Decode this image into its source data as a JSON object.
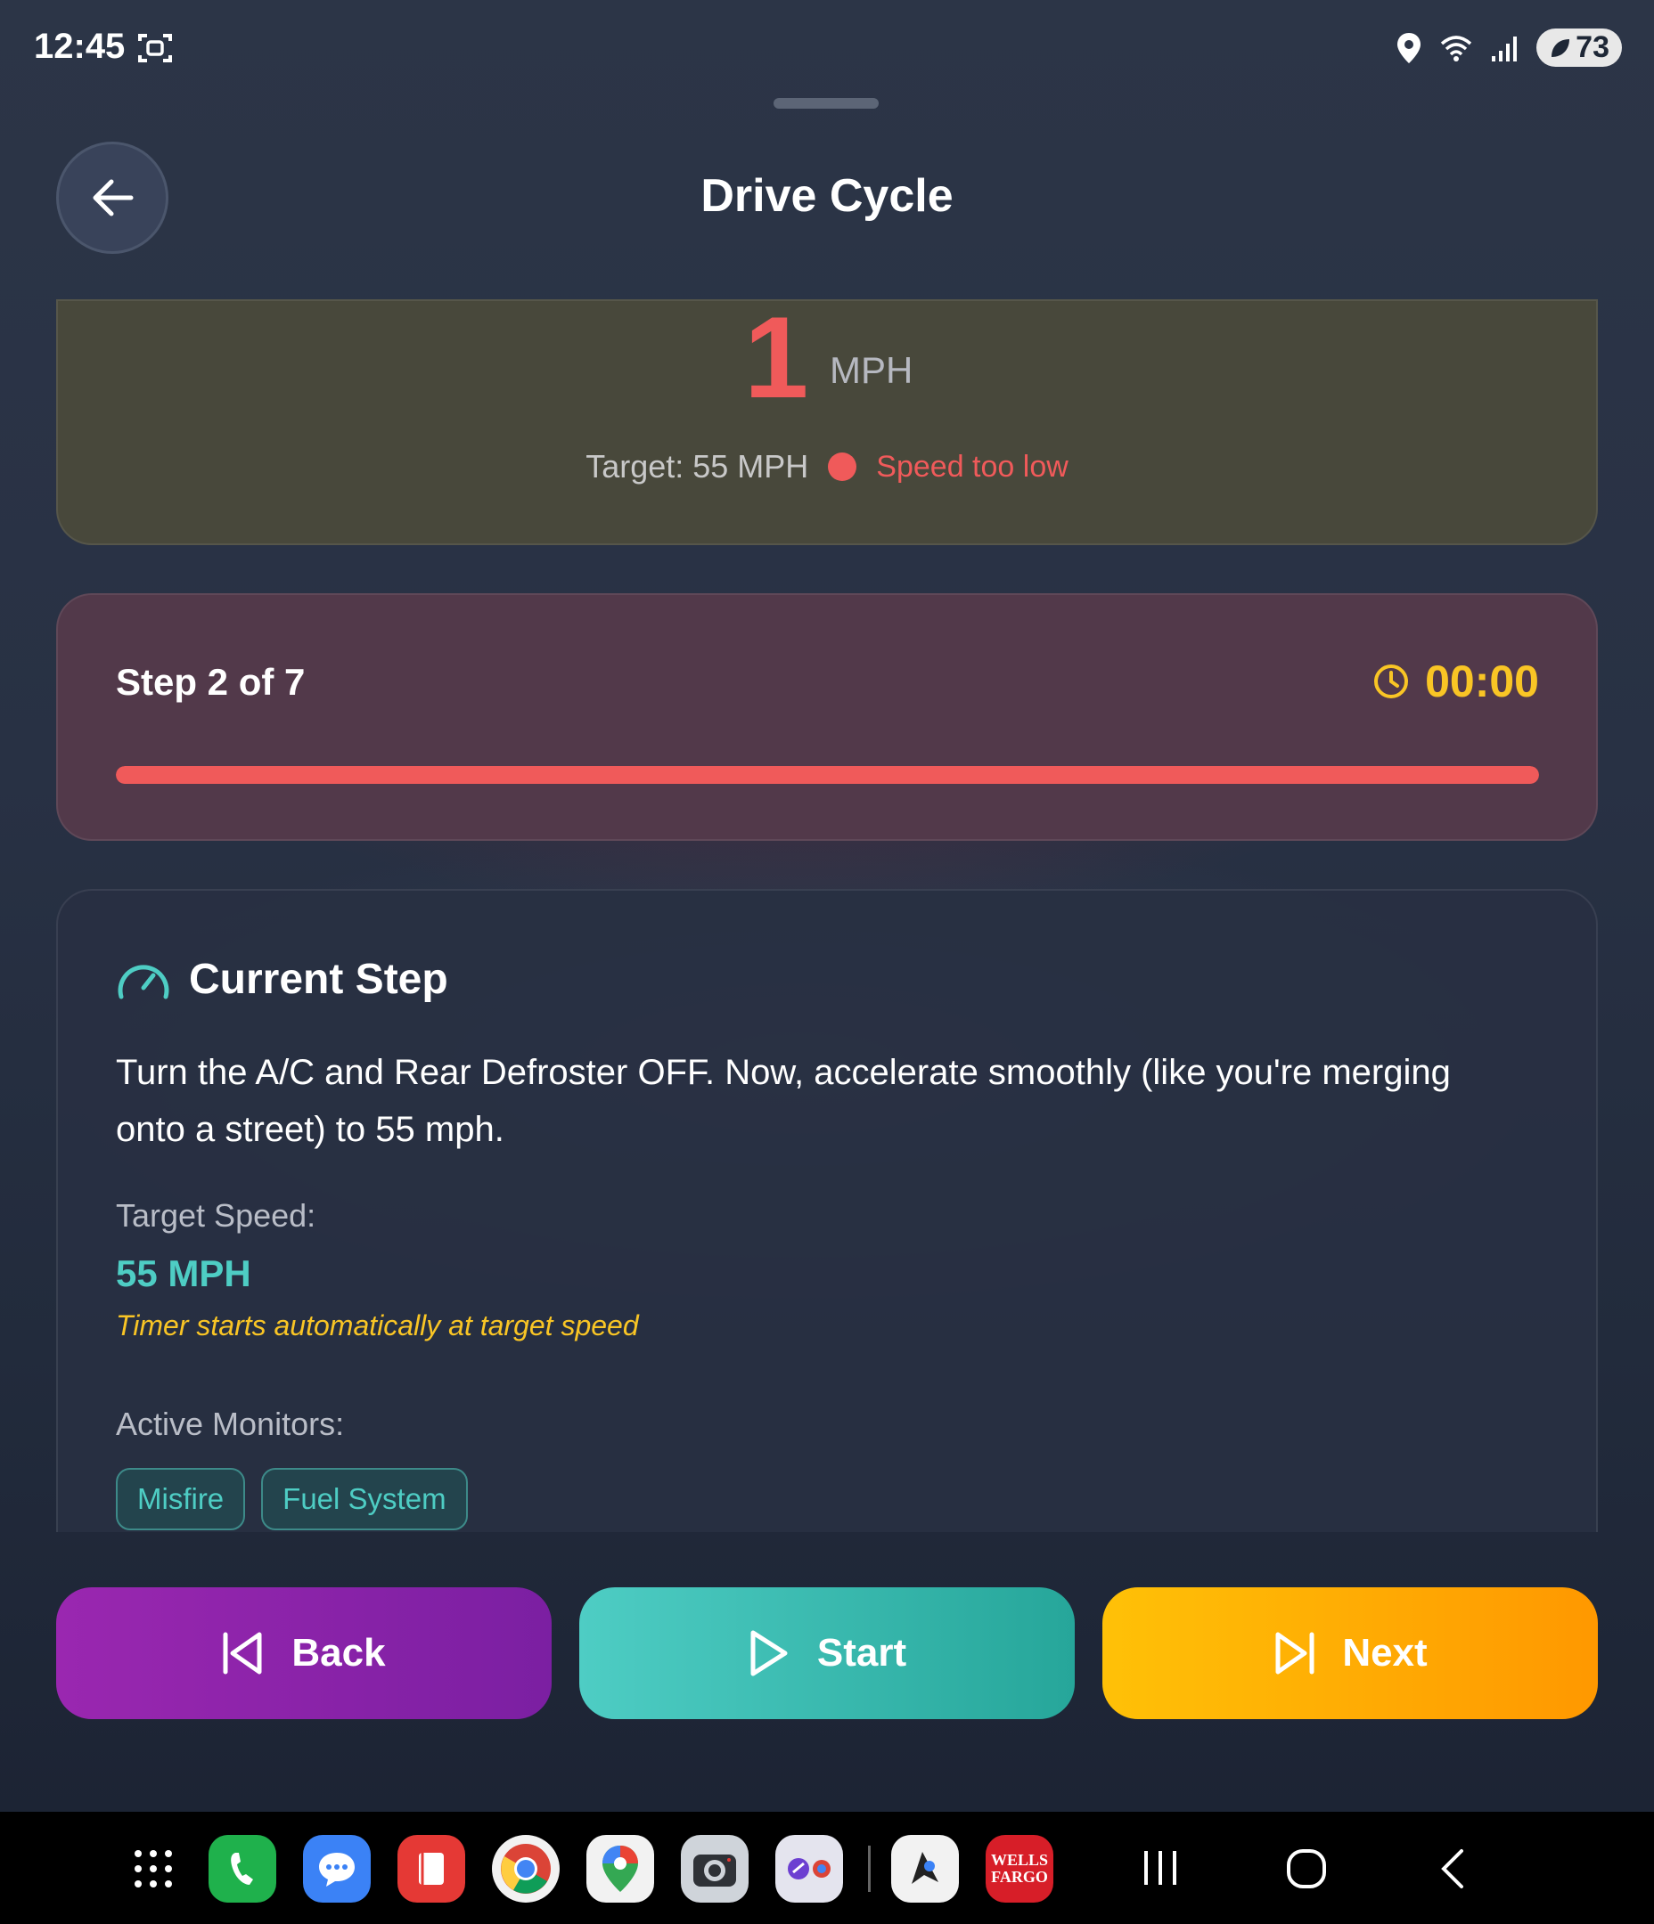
{
  "status_bar": {
    "time": "12:45",
    "battery": "73",
    "icons": [
      "screenshot-icon",
      "location-icon",
      "wifi-icon",
      "signal-icon",
      "battery-icon"
    ]
  },
  "header": {
    "title": "Drive Cycle",
    "back_icon": "arrow-left-icon"
  },
  "speed": {
    "value": "1",
    "unit": "MPH",
    "target": "Target: 55 MPH",
    "status": "Speed too low"
  },
  "progress": {
    "step_label": "Step 2 of 7",
    "timer": "00:00",
    "fill_fraction": 1.0
  },
  "current_step": {
    "title": "Current Step",
    "instructions": "Turn the A/C and Rear Defroster OFF. Now, accelerate smoothly (like you're merging onto a street) to 55 mph.",
    "target_label": "Target Speed:",
    "target_value": "55 MPH",
    "timer_note": "Timer starts automatically at target speed",
    "monitors_label": "Active Monitors:",
    "monitors": [
      "Misfire",
      "Fuel System"
    ]
  },
  "buttons": {
    "back": "Back",
    "start": "Start",
    "next": "Next"
  },
  "nav_bar": {
    "wells_fargo_line1": "WELLS",
    "wells_fargo_line2": "FARGO"
  },
  "colors": {
    "accent_red": "#f05a5a",
    "accent_teal": "#4ecdc4",
    "accent_yellow": "#f9c525",
    "back_purple": "#9a27b0",
    "next_orange": "#ffc107"
  }
}
